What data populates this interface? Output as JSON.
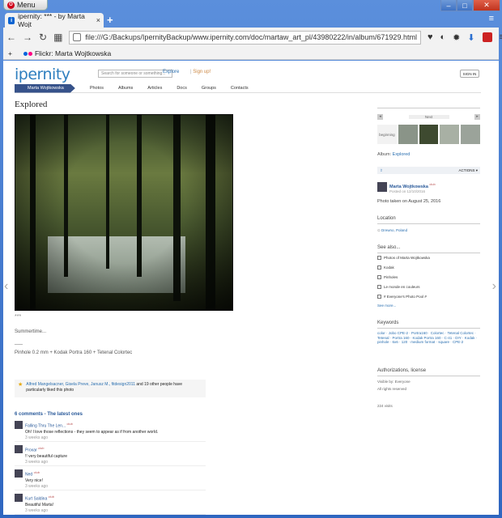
{
  "browser": {
    "menu_label": "Menu",
    "tab_title": "ipernity: *** - by Marta Wojt",
    "tab_close": "×",
    "new_tab": "+",
    "address": "file:///G:/Backups/IpernityBackup/www.ipernity.com/doc/martaw_art_pl/43980222/in/album/671929.html",
    "bookmark": "Flickr: Marta Wojtkowska",
    "bookmark_plus": "+"
  },
  "site": {
    "logo": "ipernity",
    "search_placeholder": "Search for someone or something...",
    "explore": "Explore",
    "separator": "|",
    "signup": "Sign up!",
    "signin": "SIGN IN",
    "nav_owner": "Marta Wojtkowska",
    "nav": [
      "Photos",
      "Albums",
      "Articles",
      "Docs",
      "Groups",
      "Contacts"
    ]
  },
  "photo": {
    "title": "Explored",
    "stars": "***",
    "desc1": "Summertime...",
    "dash": "___",
    "desc2": "Pinhole 0.2 mm + Kodak Portra 160 + Tetenal Colortec"
  },
  "faves": {
    "names": "Alfred Mangelsacner, Gisela Preve, Janusz M., fitdesign2011",
    "rest": " and 19 other people have particularly liked this photo"
  },
  "comments_header": "6 comments - The latest ones",
  "comments": [
    {
      "name": "Falling Thru The Len...",
      "badge": "club",
      "text": "Oh! I love those reflections - they seem to appear as if from another world.",
      "time": "3 weeks ago"
    },
    {
      "name": "Proxar",
      "badge": "club",
      "text": "!! very beautiful capture",
      "time": "3 weeks ago"
    },
    {
      "name": "Ned",
      "badge": "club",
      "text": "Very nice!",
      "time": "3 weeks ago"
    },
    {
      "name": "Kurt Saldina",
      "badge": "club",
      "text": "Beautiful Marta!",
      "time": "3 weeks ago"
    }
  ],
  "sidebar": {
    "prev": "◂",
    "next_label": "Next",
    "next": "▸",
    "beginning": "beginning",
    "album_label": "Album:",
    "album": "Explored",
    "actions": "ACTIONS ▾",
    "owner": "Marta Wojtkowska",
    "owner_badge": "club",
    "posted": "Posted on 12/10/2016",
    "taken": "Photo taken on August 25, 2016",
    "location_h": "Location",
    "location": "Drewno, Poland",
    "see_h": "See also...",
    "see": [
      "Photos of Marta Wojtkowska",
      "Kodak",
      "Pinholes",
      "Le monde en couleurs",
      "# Everyone's Photo Pool #"
    ],
    "see_more": "See more...",
    "keywords_h": "Keywords",
    "keywords": "color · Jobo CPE-2 · Portra160 · Colortec · Tetenal Colortec · Tetenal · Portra 160 · Kodak Portra 160 · C-41 · DIY · Kodak · pinhole · 6x6 · 120 · medium format · square · CPE-2",
    "auth_h": "Authorizations, license",
    "visible": "Visible by: Everyone",
    "rights": "All rights reserved",
    "visits": "224 visits"
  }
}
